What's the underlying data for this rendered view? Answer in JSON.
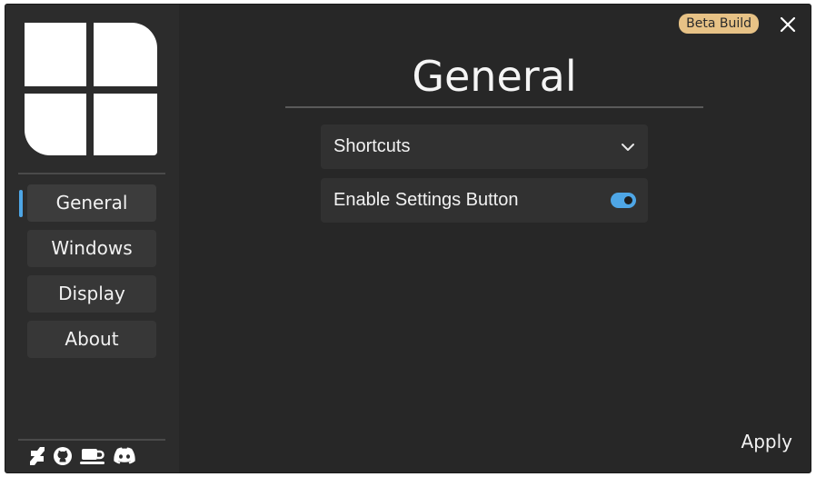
{
  "window": {
    "badge": "Beta Build",
    "close_icon": "close-icon"
  },
  "logo": {
    "icon": "windows-logo-icon"
  },
  "sidebar": {
    "items": [
      {
        "label": "General",
        "active": true
      },
      {
        "label": "Windows",
        "active": false
      },
      {
        "label": "Display",
        "active": false
      },
      {
        "label": "About",
        "active": false
      }
    ],
    "social_icons": [
      "deviantart-icon",
      "github-icon",
      "coffee-icon",
      "discord-icon"
    ]
  },
  "main": {
    "title": "General",
    "settings": [
      {
        "label": "Shortcuts",
        "control": "dropdown",
        "icon": "chevron-down-icon"
      },
      {
        "label": "Enable Settings Button",
        "control": "toggle",
        "value": true
      }
    ]
  },
  "footer": {
    "apply_label": "Apply"
  },
  "colors": {
    "accent": "#4ea6e6",
    "badge_bg": "#e7c286",
    "window_bg": "#272727",
    "sidebar_bg": "#2c2c2c"
  }
}
